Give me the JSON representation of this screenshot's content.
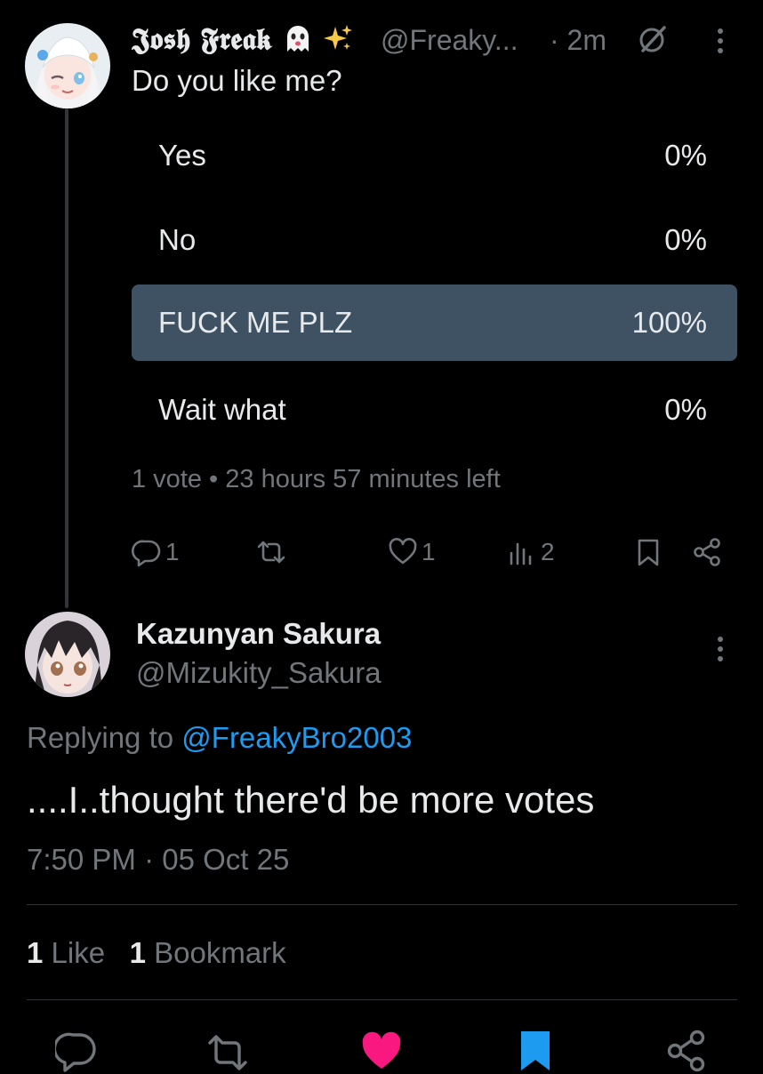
{
  "colors": {
    "background": "#000000",
    "text_primary": "#e7e9ea",
    "text_secondary": "#71767b",
    "accent_link": "#1d9bf0",
    "poll_winner_fill": "#3e5263",
    "like_active": "#f91880",
    "bookmark_active": "#1d9bf0"
  },
  "post": {
    "author_name": "𝕵𝖔𝖘𝖍 𝕱𝖗𝖊𝖆𝖐",
    "author_emojis": [
      "ghost-emoji",
      "sparkles-emoji"
    ],
    "handle": "@Freaky...",
    "time": "· 2m",
    "text": "Do you like me?",
    "poll": {
      "options": [
        {
          "label": "Yes",
          "percent": "0%",
          "share": 0.0
        },
        {
          "label": "No",
          "percent": "0%",
          "share": 0.0
        },
        {
          "label": "FUCK ME PLZ",
          "percent": "100%",
          "share": 1.0,
          "winner": true
        },
        {
          "label": "Wait what",
          "percent": "0%",
          "share": 0.0
        }
      ],
      "meta": "1 vote • 23 hours 57 minutes left"
    },
    "actions": {
      "replies": "1",
      "reposts": "",
      "likes": "1",
      "views": "2"
    }
  },
  "reply": {
    "author_name": "Kazunyan Sakura",
    "handle": "@Mizukity_Sakura",
    "replying_prefix": "Replying to",
    "replying_to": "@FreakyBro2003",
    "text": "....I..thought there'd be more votes",
    "timestamp": "7:50 PM · 05 Oct 25",
    "stats": {
      "likes_count": "1",
      "likes_label": "Like",
      "bookmarks_count": "1",
      "bookmarks_label": "Bookmark"
    }
  },
  "bottom_bar": [
    "reply-icon",
    "repost-icon",
    "like-icon",
    "bookmark-icon",
    "share-icon"
  ]
}
